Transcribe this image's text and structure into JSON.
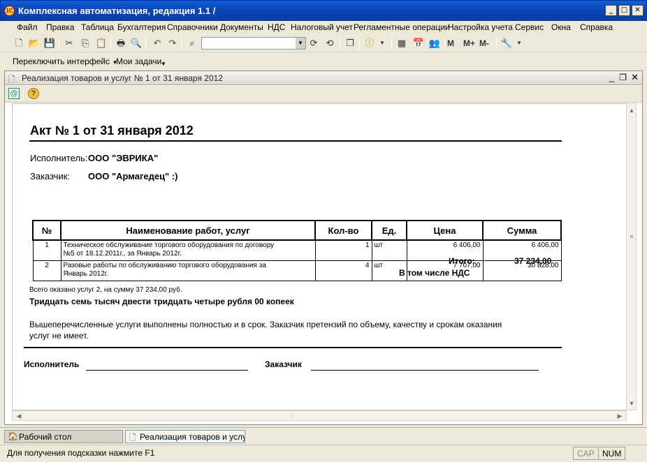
{
  "window": {
    "title": "Комплексная автоматизация, редакция 1.1 /",
    "logo_text": "1С"
  },
  "menu": [
    "Файл",
    "Правка",
    "Таблица",
    "Бухгалтерия",
    "Справочники",
    "Документы",
    "НДС",
    "Налоговый учет",
    "Регламентные операции",
    "Настройка учета",
    "Сервис",
    "Окна",
    "Справка"
  ],
  "toolbar2": {
    "switch_interface": "Переключить интерфейс",
    "my_tasks": "Мои задачи"
  },
  "toolbar1": {
    "m_buttons": [
      "M",
      "M+",
      "M-"
    ]
  },
  "search": {
    "value": ""
  },
  "doc_window": {
    "title": "Реализация товаров и услуг № 1 от 31 января 2012"
  },
  "act": {
    "title": "Акт № 1 от 31 января 2012",
    "executor_label": "Исполнитель:",
    "executor_value": "ООО \"ЭВРИКА\"",
    "customer_label": "Заказчик:",
    "customer_value": "ООО \"Армагедец\" :)",
    "columns": [
      "№",
      "Наименование работ, услуг",
      "Кол-во",
      "Ед.",
      "Цена",
      "Сумма"
    ],
    "rows": [
      {
        "num": "1",
        "name_1": "Техническое обслуживание торгового оборудования по договору",
        "name_2": "№5 от 18.12.2011г., за Январь 2012г.",
        "qty": "1",
        "unit": "шт",
        "price": "6 406,00",
        "sum": "6 406,00"
      },
      {
        "num": "2",
        "name_1": "Разовые работы по обслуживанию торгового оборудования за",
        "name_2": "Январь 2012г.",
        "qty": "4",
        "unit": "шт",
        "price": "7 707,00",
        "sum": "30 828,00"
      }
    ],
    "total_label": "Итого:",
    "total_value": "37 234,00",
    "vat_label": "В том числе НДС",
    "summary_line": "Всего оказано услуг 2, на сумму 37 234,00 руб.",
    "amount_words": "Тридцать семь тысяч двести тридцать четыре рубля 00 копеек",
    "statement_1": "Вышеперечисленные услуги выполнены полностью и в срок. Заказчик претензий по объему, качеству и срокам оказания",
    "statement_2": "услуг не имеет.",
    "sign_executor": "Исполнитель",
    "sign_customer": "Заказчик"
  },
  "taskbar": {
    "tabs": [
      "Рабочий стол",
      "Реализация товаров и услу..."
    ]
  },
  "status": {
    "hint": "Для получения подсказки нажмите F1",
    "cap": "CAP",
    "num": "NUM"
  },
  "colors": {
    "titlebar": "#0a46b8",
    "chrome": "#ece9d8"
  }
}
